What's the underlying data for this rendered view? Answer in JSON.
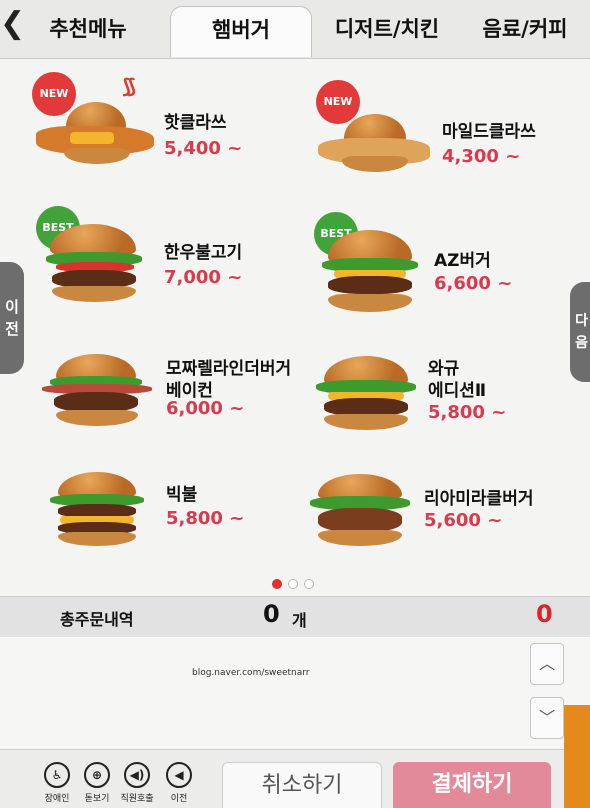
{
  "tabs": [
    {
      "label": "추천메뉴"
    },
    {
      "label": "햄버거"
    },
    {
      "label": "디저트/치킨"
    },
    {
      "label": "음료/커피"
    }
  ],
  "nav": {
    "prev_label": "이\n전",
    "next_label": "다\n음",
    "back_glyph": "❮"
  },
  "items": [
    {
      "name": "핫클라쓰",
      "price": "5,400 ~",
      "badge": "NEW"
    },
    {
      "name": "마일드클라쓰",
      "price": "4,300 ~",
      "badge": "NEW"
    },
    {
      "name": "한우불고기",
      "price": "7,000 ~",
      "badge": "BEST"
    },
    {
      "name": "AZ버거",
      "price": "6,600 ~",
      "badge": "BEST"
    },
    {
      "name": "모짜렐라인더버거\n베이컨",
      "price": "6,000 ~",
      "badge": ""
    },
    {
      "name": "와규\n에디션Ⅱ",
      "price": "5,800 ~",
      "badge": ""
    },
    {
      "name": "빅불",
      "price": "5,800 ~",
      "badge": ""
    },
    {
      "name": "리아미라클버거",
      "price": "5,600 ~",
      "badge": ""
    }
  ],
  "pagination": {
    "current": 1,
    "total": 3
  },
  "order": {
    "label": "총주문내역",
    "count": "0",
    "unit": "개",
    "total": "0"
  },
  "watermark": "blog.naver.com/sweetnarr",
  "accessibility": [
    {
      "label": "장애인",
      "icon": "wheelchair-icon",
      "glyph": "♿"
    },
    {
      "label": "돋보기",
      "icon": "magnifier-icon",
      "glyph": "⊕"
    },
    {
      "label": "직원호출",
      "icon": "call-staff-icon",
      "glyph": "◀)"
    },
    {
      "label": "이전",
      "icon": "back-icon",
      "glyph": "◀"
    }
  ],
  "actions": {
    "cancel": "취소하기",
    "pay": "결제하기"
  },
  "colors": {
    "price": "#d93a4e",
    "new_badge": "#e23a3a",
    "best_badge": "#43a33b",
    "pay_button": "#e2899a",
    "total": "#d8262a"
  }
}
